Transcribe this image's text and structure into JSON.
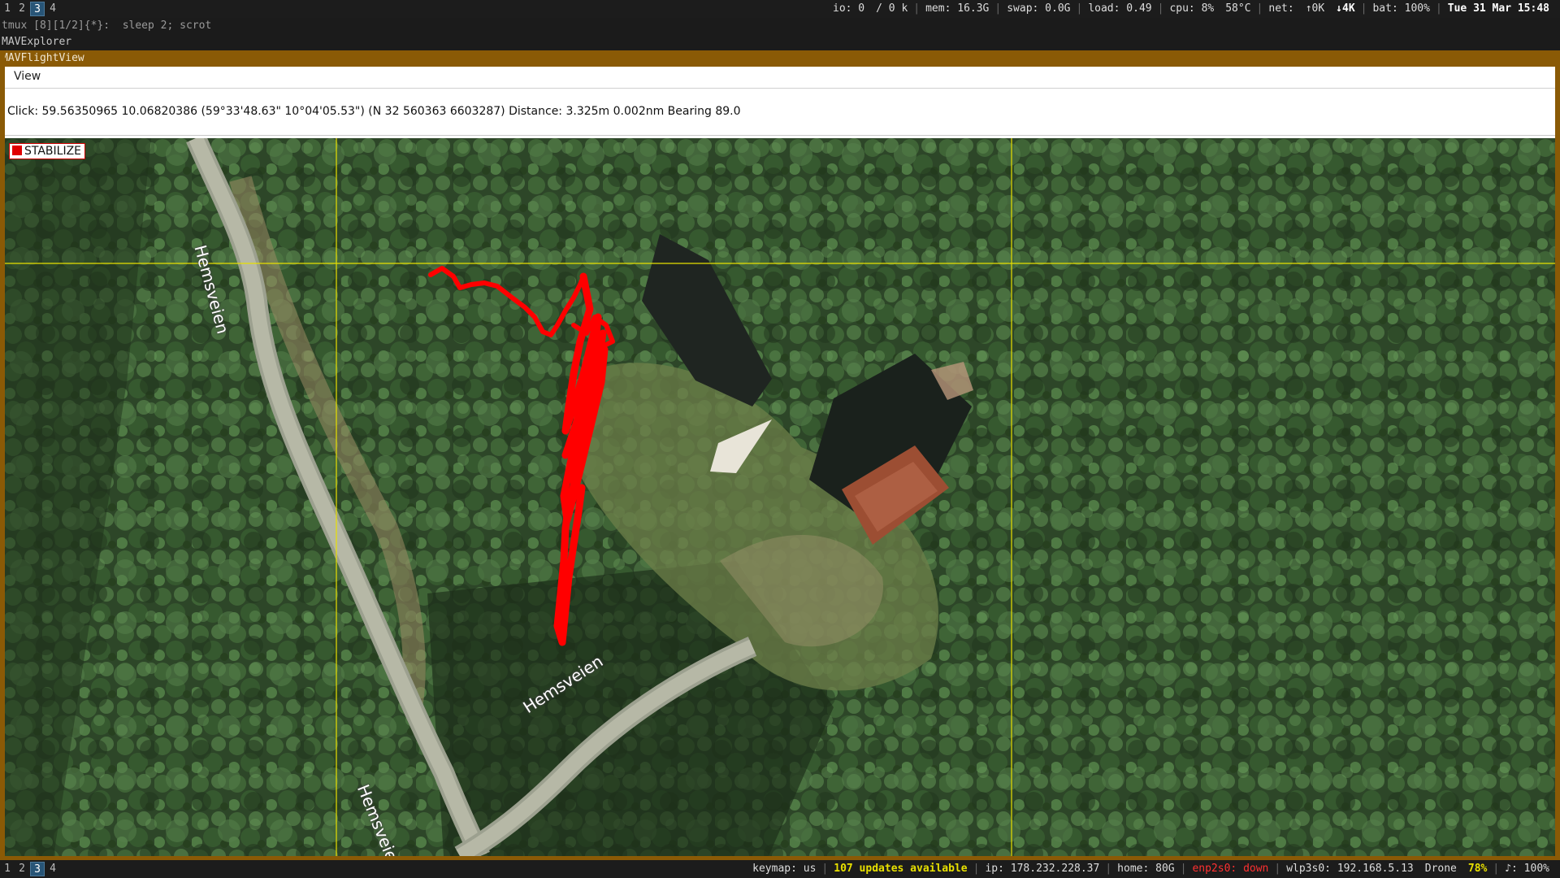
{
  "top_bar": {
    "workspaces": [
      "1",
      "2",
      "3",
      "4"
    ],
    "active_workspace": "3",
    "status": {
      "io": "io: 0",
      "disk": "/     0 k",
      "mem": "mem: 16.3G",
      "swap": "swap: 0.0G",
      "load": "load: 0.49",
      "cpu": "cpu:    8%",
      "temp": "58°C",
      "net_label": "net:",
      "net_up": "↑0K",
      "net_down": "↓4K",
      "bat": "bat: 100%",
      "datetime": "Tue 31 Mar 15:48"
    }
  },
  "tmux_line": "tmux [8][1/2]{*}:  sleep 2; scrot",
  "explorer_title": "MAVExplorer",
  "flight_view_title": "MAVFlightView",
  "menu": {
    "view": "View"
  },
  "click_info": "Click: 59.56350965 10.06820386 (59°33'48.63\" 10°04'05.53\") (N 32 560363 6603287)  Distance: 3.325m 0.002nm Bearing 89.0",
  "mode_badge": "STABILIZE",
  "road_labels": {
    "road_a": "Hemsveien",
    "road_b": "Hemsveien",
    "road_c": "Hemsveien"
  },
  "colors": {
    "track": "#ff0000",
    "grid": "#e8e000",
    "frame": "#8a5a06",
    "active_ws": "#285577",
    "warn": "#e8e000",
    "error": "#ff3030"
  },
  "bottom_bar": {
    "workspaces": [
      "1",
      "2",
      "3",
      "4"
    ],
    "active_workspace": "3",
    "status": {
      "keymap": "keymap: us",
      "updates": "107 updates available",
      "ip": "ip: 178.232.228.37",
      "home": "home: 80G",
      "enp": "enp2s0: down",
      "wlp": "wlp3s0: 192.168.5.13",
      "drone_label": "Drone",
      "drone_pct": "78%",
      "volume": "♪: 100%"
    }
  }
}
